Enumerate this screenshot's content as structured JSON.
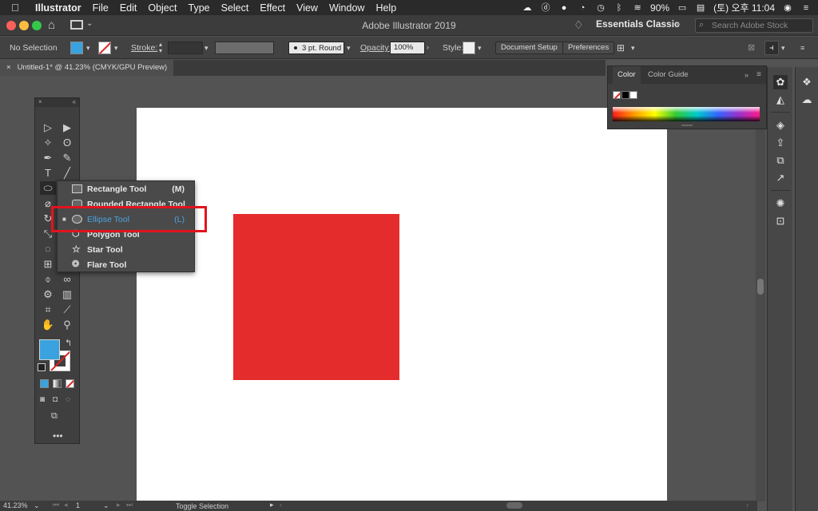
{
  "menubar": {
    "app": "Illustrator",
    "items": [
      "File",
      "Edit",
      "Object",
      "Type",
      "Select",
      "Effect",
      "View",
      "Window",
      "Help"
    ],
    "battery": "90%",
    "datetime": "(토) 오후 11:04"
  },
  "titlebar": {
    "title": "Adobe Illustrator 2019",
    "workspace": "Essentials Classic",
    "search_placeholder": "Search Adobe Stock"
  },
  "controlbar": {
    "selection": "No Selection",
    "stroke_label": "Stroke:",
    "brush": "3 pt. Round",
    "opacity_label": "Opacity:",
    "opacity_value": "100%",
    "style_label": "Style:",
    "document_setup": "Document Setup",
    "preferences": "Preferences"
  },
  "document_tab": {
    "close": "×",
    "title": "Untitled-1* @ 41.23% (CMYK/GPU Preview)"
  },
  "flyout": {
    "items": [
      {
        "label": "Rectangle Tool",
        "shortcut": "(M)",
        "icon": "rectangle-icon"
      },
      {
        "label": "Rounded Rectangle Tool",
        "shortcut": "",
        "icon": "rounded-rectangle-icon"
      },
      {
        "label": "Ellipse Tool",
        "shortcut": "(L)",
        "icon": "ellipse-icon"
      },
      {
        "label": "Polygon Tool",
        "shortcut": "",
        "icon": "polygon-icon"
      },
      {
        "label": "Star Tool",
        "shortcut": "",
        "icon": "star-icon"
      },
      {
        "label": "Flare Tool",
        "shortcut": "",
        "icon": "flare-icon"
      }
    ],
    "selected": "Ellipse Tool"
  },
  "color_panel": {
    "tabs": [
      "Color",
      "Color Guide"
    ]
  },
  "statusbar": {
    "zoom": "41.23%",
    "artboard": "1",
    "status": "Toggle Selection"
  },
  "colors": {
    "fill": "#3aa2de",
    "rectangle": "#e52c2c",
    "highlight": "#e1141c",
    "selected_item": "#4aa3df"
  }
}
